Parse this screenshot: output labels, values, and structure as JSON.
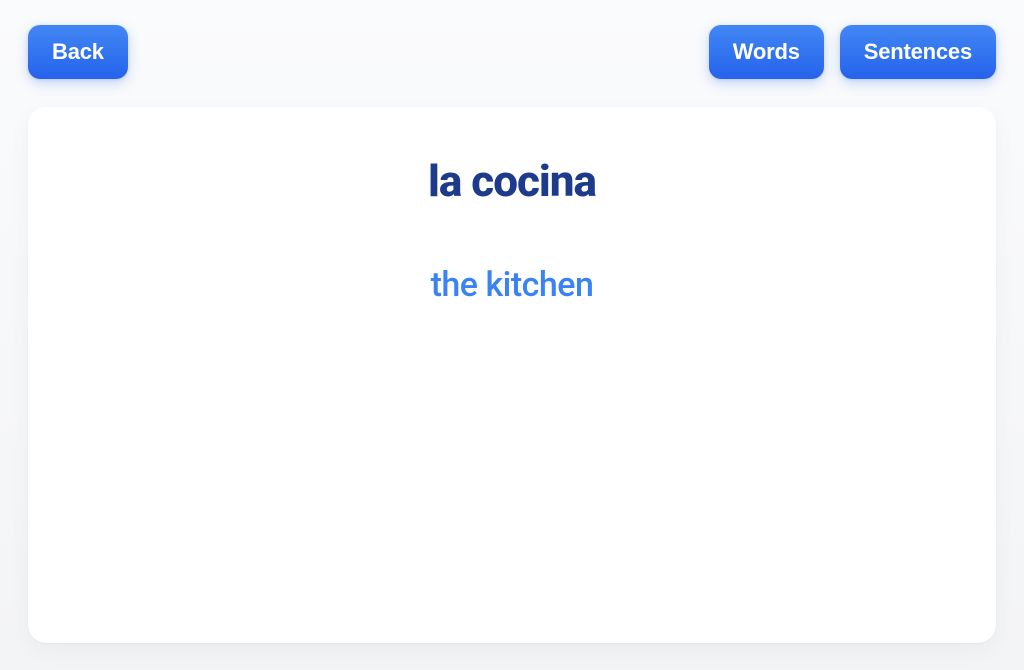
{
  "header": {
    "back_label": "Back",
    "words_label": "Words",
    "sentences_label": "Sentences"
  },
  "card": {
    "word": "la cocina",
    "translation": "the kitchen"
  }
}
